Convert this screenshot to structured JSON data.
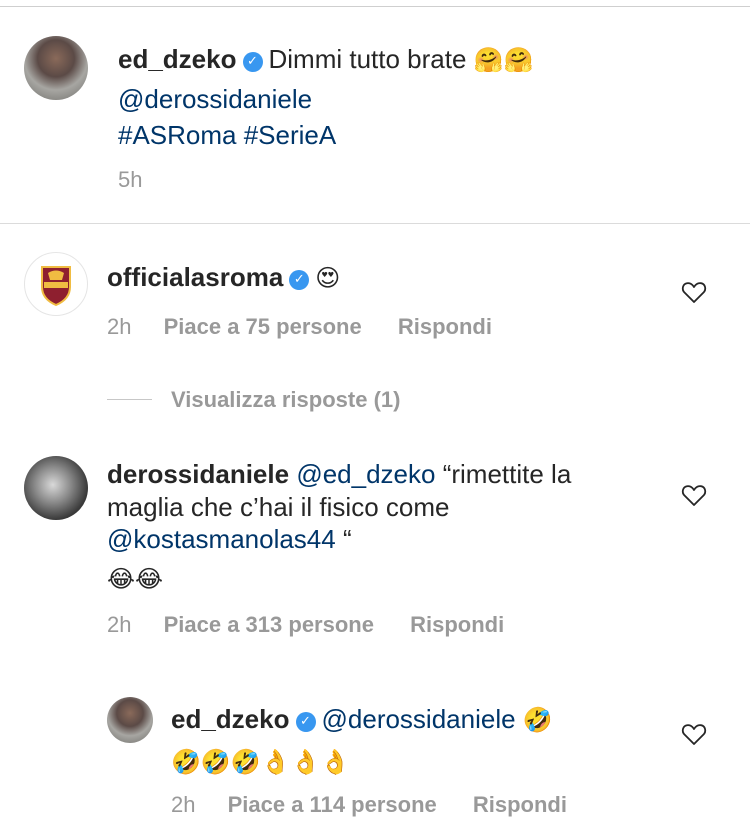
{
  "caption": {
    "username": "ed_dzeko",
    "text": "Dimmi tutto brate",
    "emojis": "🤗🤗",
    "mention": "@derossidaniele",
    "hashtags": "#ASRoma #SerieA",
    "time": "5h"
  },
  "comments": [
    {
      "username": "officialasroma",
      "text": "😍",
      "time": "2h",
      "likes": "Piace a 75 persone",
      "reply_label": "Rispondi",
      "view_replies": "Visualizza risposte (1)"
    },
    {
      "username": "derossidaniele",
      "mention": "@ed_dzeko",
      "text_line1": "“rimettite la",
      "text_line2": "maglia che c’hai il fisico come",
      "mention2": "@kostasmanolas44",
      "text_line3_end": " “",
      "emojis": "😂😂",
      "time": "2h",
      "likes": "Piace a 313 persone",
      "reply_label": "Rispondi"
    },
    {
      "username": "ed_dzeko",
      "mention": "@derossidaniele",
      "emoji_inline": "🤣",
      "emojis": "🤣🤣🤣👌👌👌",
      "time": "2h",
      "likes": "Piace a 114 persone",
      "reply_label": "Rispondi"
    }
  ],
  "colors": {
    "link": "#003569",
    "verified": "#3897f0",
    "meta": "#999999"
  }
}
